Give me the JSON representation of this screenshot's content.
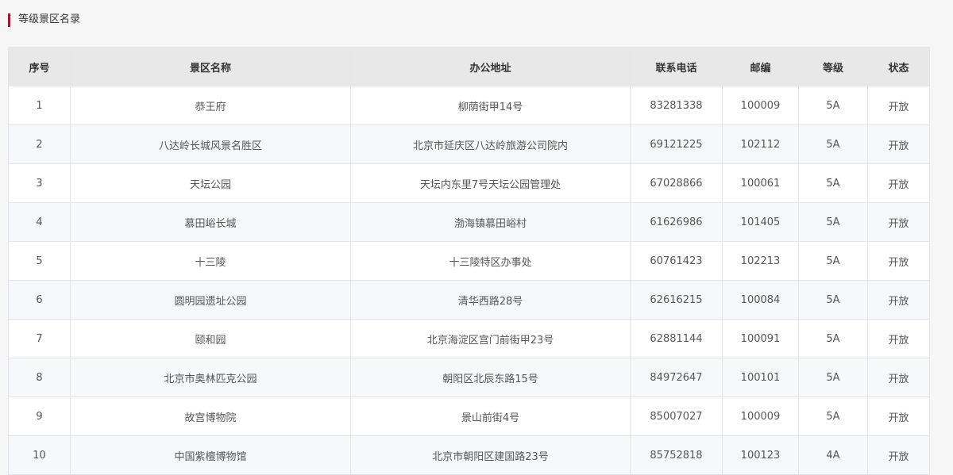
{
  "section": {
    "title": "等级景区名录",
    "accent_color": "#b3132e"
  },
  "table": {
    "headers": [
      "序号",
      "景区名称",
      "办公地址",
      "联系电话",
      "邮编",
      "等级",
      "状态"
    ],
    "rows": [
      [
        "1",
        "恭王府",
        "柳荫街甲14号",
        "83281338",
        "100009",
        "5A",
        "开放"
      ],
      [
        "2",
        "八达岭长城风景名胜区",
        "北京市延庆区八达岭旅游公司院内",
        "69121225",
        "102112",
        "5A",
        "开放"
      ],
      [
        "3",
        "天坛公园",
        "天坛内东里7号天坛公园管理处",
        "67028866",
        "100061",
        "5A",
        "开放"
      ],
      [
        "4",
        "慕田峪长城",
        "渤海镇慕田峪村",
        "61626986",
        "101405",
        "5A",
        "开放"
      ],
      [
        "5",
        "十三陵",
        "十三陵特区办事处",
        "60761423",
        "102213",
        "5A",
        "开放"
      ],
      [
        "6",
        "圆明园遗址公园",
        "清华西路28号",
        "62616215",
        "100084",
        "5A",
        "开放"
      ],
      [
        "7",
        "颐和园",
        "北京海淀区宫门前街甲23号",
        "62881144",
        "100091",
        "5A",
        "开放"
      ],
      [
        "8",
        "北京市奥林匹克公园",
        "朝阳区北辰东路15号",
        "84972647",
        "100101",
        "5A",
        "开放"
      ],
      [
        "9",
        "故宫博物院",
        "景山前街4号",
        "85007027",
        "100009",
        "5A",
        "开放"
      ],
      [
        "10",
        "中国紫檀博物馆",
        "北京市朝阳区建国路23号",
        "85752818",
        "100123",
        "4A",
        "开放"
      ]
    ]
  }
}
